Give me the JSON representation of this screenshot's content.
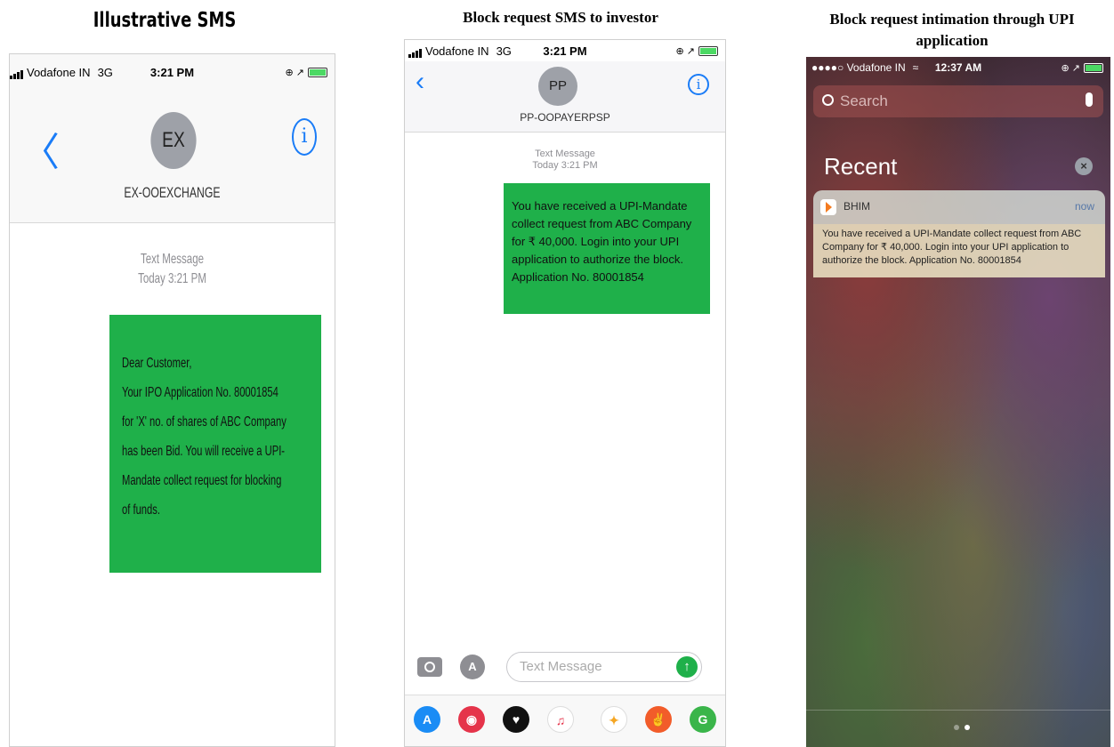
{
  "captions": {
    "left": "Illustrative SMS",
    "middle": "Block request SMS to investor",
    "right": "Block request intimation through UPI application"
  },
  "phone1": {
    "carrier": "Vodafone IN",
    "network": "3G",
    "time": "3:21 PM",
    "avatar_initials": "EX",
    "contact_name": "EX-OOEXCHANGE",
    "message_meta_line1": "Text Message",
    "message_meta_line2": "Today 3:21 PM",
    "message_lines": [
      "Dear Customer,",
      "Your IPO Application No. 80001854",
      "for 'X' no. of shares of ABC Company",
      "has been Bid. You will receive a UPI-",
      "Mandate collect request for blocking",
      "of funds."
    ]
  },
  "phone2": {
    "carrier": "Vodafone IN",
    "network": "3G",
    "time": "3:21 PM",
    "avatar_initials": "PP",
    "contact_name": "PP-OOPAYERPSP",
    "message_meta_line1": "Text Message",
    "message_meta_line2": "Today 3:21 PM",
    "message": "You have received a UPI-Mandate collect request from ABC Company for ₹ 40,000. Login into your UPI application to authorize the block. Application No. 80001854",
    "input_placeholder": "Text Message"
  },
  "phone3": {
    "carrier": "●●●●○ Vodafone IN",
    "time": "12:37 AM",
    "search_placeholder": "Search",
    "recent_label": "Recent",
    "notification": {
      "app": "BHIM",
      "when": "now",
      "body": "You have received a UPI-Mandate collect request from ABC Company for ₹ 40,000. Login into your UPI application to authorize the block. Application No. 80001854"
    }
  },
  "colors": {
    "bubble_green": "#1fb04a",
    "ios_blue": "#1a7cf7"
  },
  "icons": [
    "back-chevron-icon",
    "info-icon",
    "camera-icon",
    "app-store-icon",
    "send-arrow-icon",
    "search-icon",
    "microphone-icon",
    "close-circle-icon",
    "bhim-logo-icon"
  ]
}
